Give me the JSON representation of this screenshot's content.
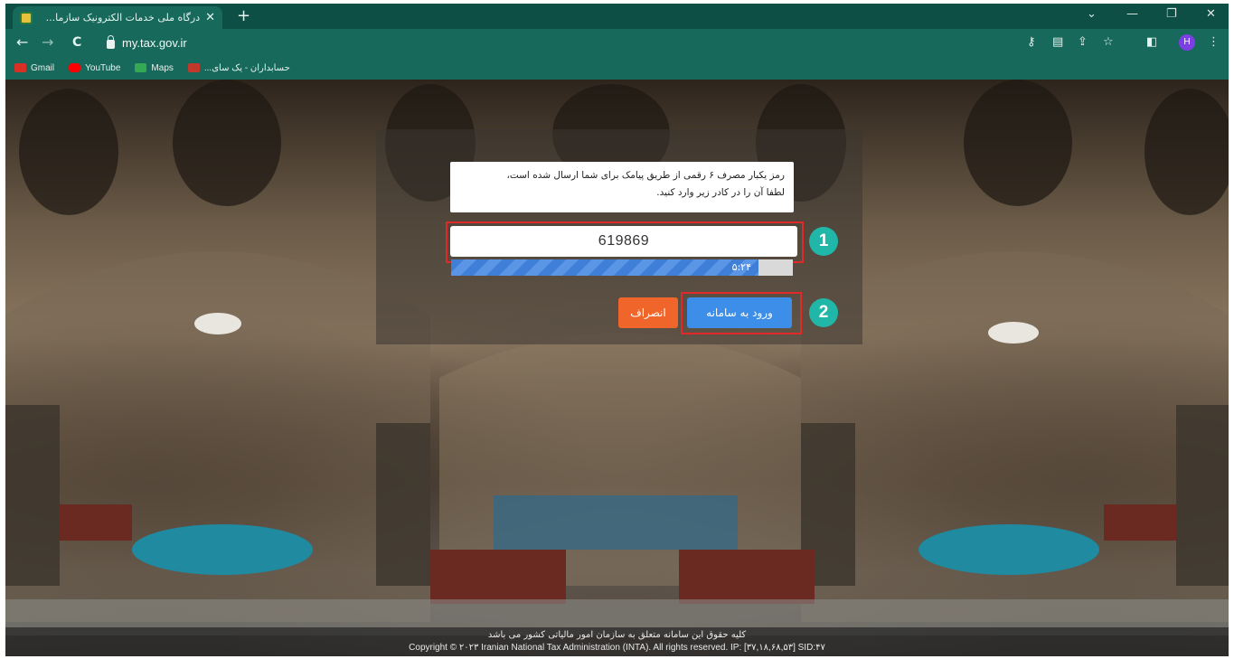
{
  "browser": {
    "tab_title": "درگاه ملی خدمات الکترونیک سازما...",
    "tab_close": "✕",
    "new_tab": "+",
    "window_controls": [
      "⌄",
      "—",
      "❐",
      "✕"
    ],
    "nav": {
      "back": "←",
      "forward": "→",
      "reload": "C"
    },
    "url": "my.tax.gov.ir",
    "profile_initial": "H",
    "bookmarks": [
      {
        "label": "Gmail",
        "color": "#d93025"
      },
      {
        "label": "YouTube",
        "color": "#ff0000"
      },
      {
        "label": "Maps",
        "color": "#34a853"
      },
      {
        "label": "حسابداران - یک سای...",
        "color": "#c0392b"
      }
    ]
  },
  "dialog": {
    "message_line1": "رمز یکبار مصرف ۶ رقمی از طریق پیامک برای شما ارسال شده است،",
    "message_line2": "لطفا آن را در کادر زیر وارد کنید.",
    "otp_value": "619869",
    "timer": "۵:۲۴",
    "timer_progress": 0.9,
    "login_button": "ورود به سامانه",
    "cancel_button": "انصراف",
    "marker1": "1",
    "marker2": "2"
  },
  "footer": {
    "line1": "کلیه حقوق این سامانه متعلق به سازمان امور مالیاتی کشور می باشد",
    "line2": "Copyright © ۲۰۲۳ Iranian National Tax Administration (INTA). All rights reserved. IP: [۳۷,۱۸,۶۸,۵۳] SID:۴۷"
  }
}
